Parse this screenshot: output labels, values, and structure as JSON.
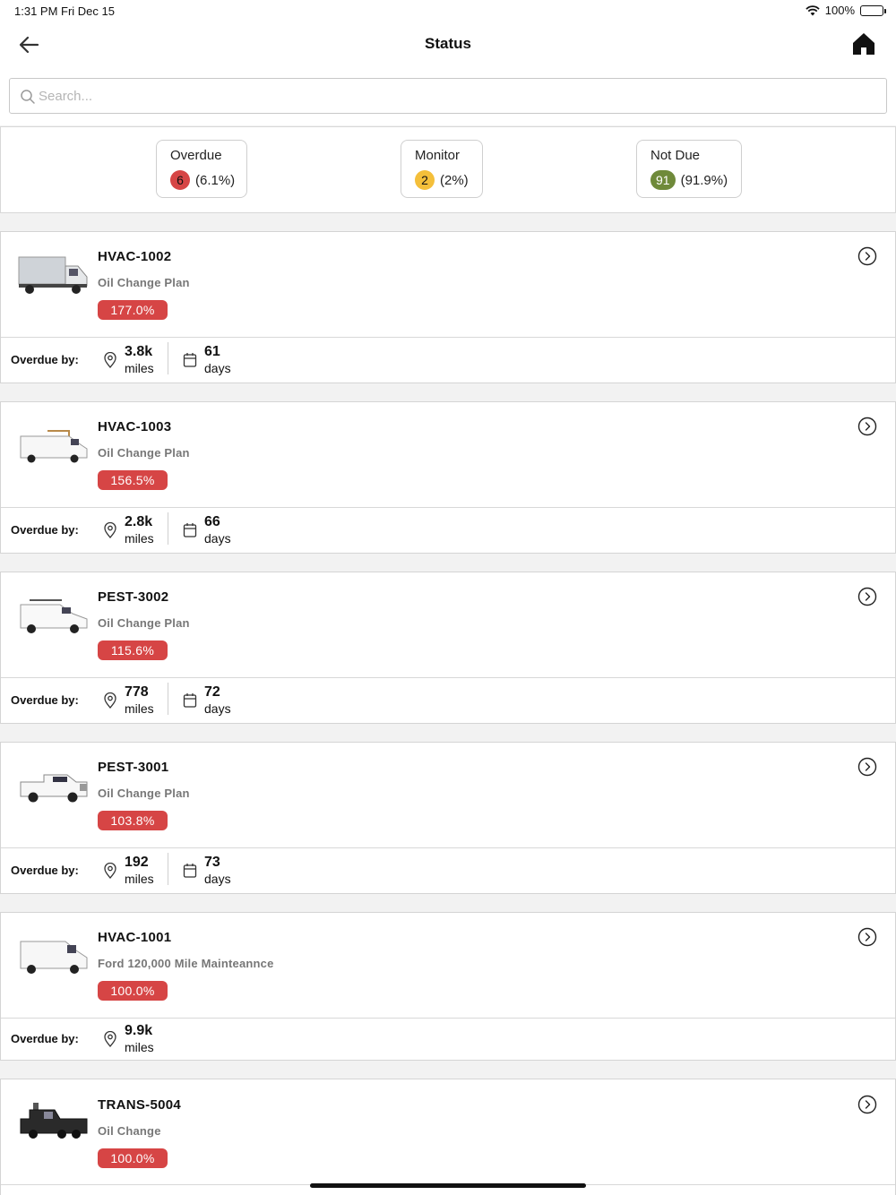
{
  "status_bar": {
    "time": "1:31 PM",
    "date": "Fri Dec 15",
    "battery": "100%"
  },
  "nav": {
    "title": "Status"
  },
  "search": {
    "placeholder": "Search..."
  },
  "summary": [
    {
      "label": "Overdue",
      "count": "6",
      "percent": "(6.1%)",
      "color": "#d64545"
    },
    {
      "label": "Monitor",
      "count": "2",
      "percent": "(2%)",
      "color": "#f4bf3a"
    },
    {
      "label": "Not Due",
      "count": "91",
      "percent": "(91.9%)",
      "color": "#6f8a3a"
    }
  ],
  "overdue_label": "Overdue by:",
  "vehicles": [
    {
      "name": "HVAC-1002",
      "plan": "Oil Change Plan",
      "percent": "177.0%",
      "miles": "3.8k",
      "miles_unit": "miles",
      "days": "61",
      "days_unit": "days",
      "thumb_icon": "box-truck-image"
    },
    {
      "name": "HVAC-1003",
      "plan": "Oil Change Plan",
      "percent": "156.5%",
      "miles": "2.8k",
      "miles_unit": "miles",
      "days": "66",
      "days_unit": "days",
      "thumb_icon": "cargo-van-image"
    },
    {
      "name": "PEST-3002",
      "plan": "Oil Change Plan",
      "percent": "115.6%",
      "miles": "778",
      "miles_unit": "miles",
      "days": "72",
      "days_unit": "days",
      "thumb_icon": "compact-van-image"
    },
    {
      "name": "PEST-3001",
      "plan": "Oil Change Plan",
      "percent": "103.8%",
      "miles": "192",
      "miles_unit": "miles",
      "days": "73",
      "days_unit": "days",
      "thumb_icon": "pickup-truck-image"
    },
    {
      "name": "HVAC-1001",
      "plan": "Ford 120,000 Mile Mainteannce",
      "percent": "100.0%",
      "miles": "9.9k",
      "miles_unit": "miles",
      "thumb_icon": "transit-van-image"
    },
    {
      "name": "TRANS-5004",
      "plan": "Oil Change",
      "percent": "100.0%",
      "thumb_icon": "semi-truck-image"
    }
  ]
}
